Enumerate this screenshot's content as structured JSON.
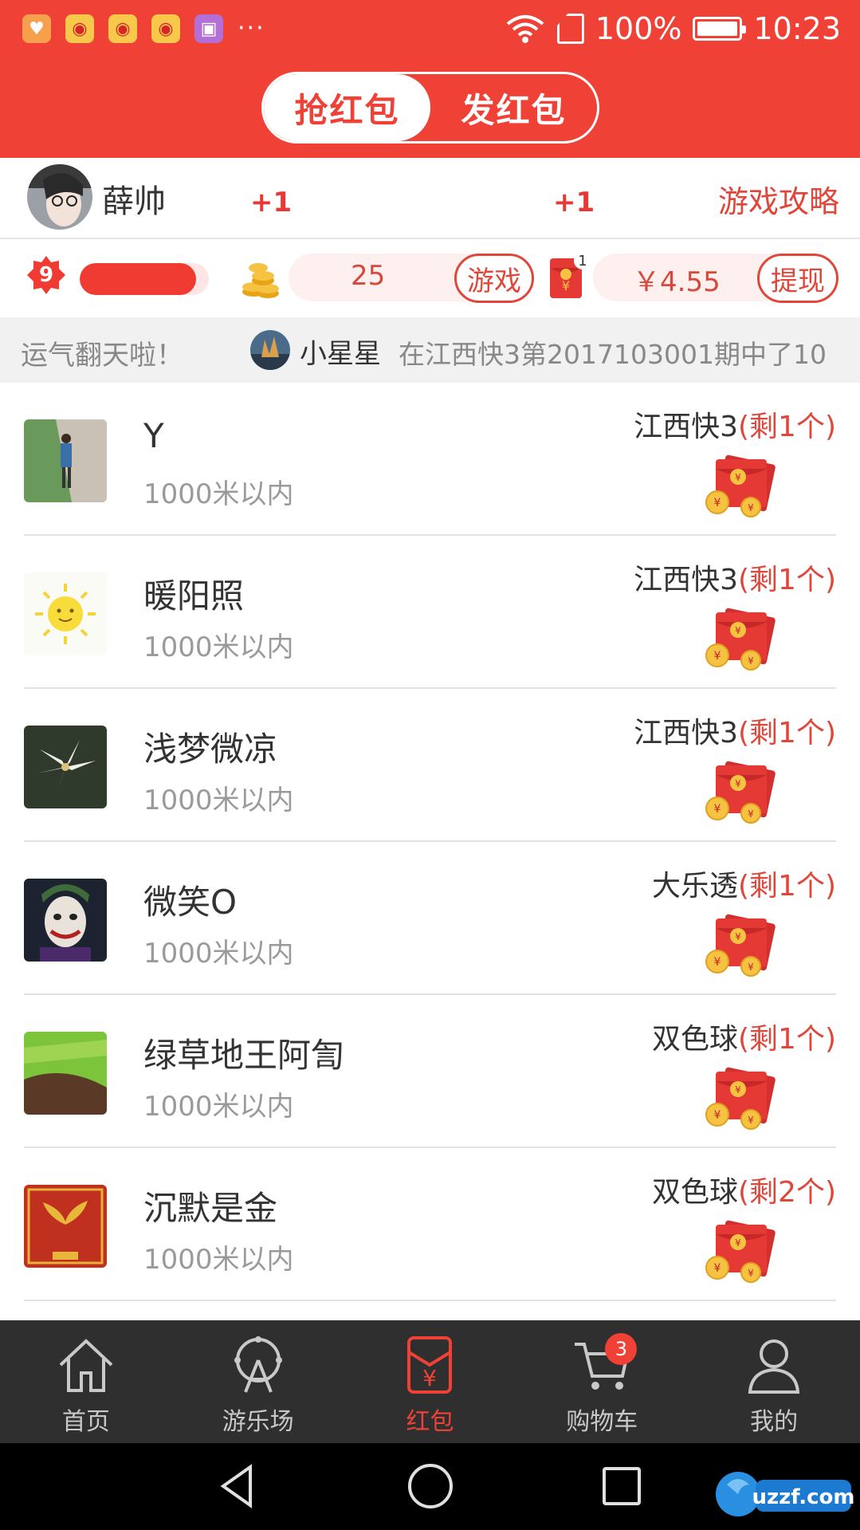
{
  "status_bar": {
    "battery": "100%",
    "time": "10:23",
    "overflow": "···"
  },
  "header": {
    "tab_grab": "抢红包",
    "tab_send": "发红包"
  },
  "user": {
    "name": "薛帅",
    "plus_one_a": "+1",
    "plus_one_b": "+1",
    "guide_link": "游戏攻略"
  },
  "stats": {
    "level": "9",
    "coins": "25",
    "game_button": "游戏",
    "packet_count": "1",
    "balance": "￥4.55",
    "withdraw_button": "提现"
  },
  "marquee": {
    "lead": "运气翻天啦！",
    "name": "小星星",
    "text": "在江西快3第2017103001期中了10"
  },
  "items": [
    {
      "name": "Y",
      "distance": "1000米以内",
      "lottery": "江西快3",
      "remaining": "(剩1个)"
    },
    {
      "name": "暖阳照",
      "distance": "1000米以内",
      "lottery": "江西快3",
      "remaining": "(剩1个)"
    },
    {
      "name": "浅梦微凉",
      "distance": "1000米以内",
      "lottery": "江西快3",
      "remaining": "(剩1个)"
    },
    {
      "name": "微笑O",
      "distance": "1000米以内",
      "lottery": "大乐透",
      "remaining": "(剩1个)"
    },
    {
      "name": "绿草地王阿訇",
      "distance": "1000米以内",
      "lottery": "双色球",
      "remaining": "(剩1个)"
    },
    {
      "name": "沉默是金",
      "distance": "1000米以内",
      "lottery": "双色球",
      "remaining": "(剩2个)"
    }
  ],
  "tabs": [
    {
      "label": "首页",
      "icon": "home-icon"
    },
    {
      "label": "游乐场",
      "icon": "ferris-wheel-icon"
    },
    {
      "label": "红包",
      "icon": "red-packet-icon"
    },
    {
      "label": "购物车",
      "icon": "cart-icon",
      "badge": "3"
    },
    {
      "label": "我的",
      "icon": "person-icon"
    }
  ],
  "colors": {
    "brand_red": "#ef4136",
    "tab_bar": "#2f2f2f"
  },
  "watermark": {
    "logo_text": "uzzf.com"
  }
}
